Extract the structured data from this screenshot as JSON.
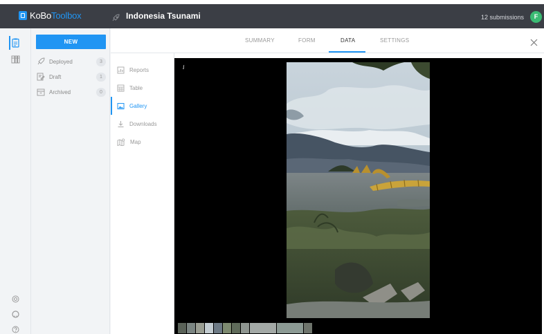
{
  "app": {
    "logo_primary": "KoBo",
    "logo_secondary": "Toolbox",
    "project_title": "Indonesia Tsunami",
    "submissions": "12 submissions",
    "avatar_initial": "F"
  },
  "sidebar": {
    "new_label": "NEW",
    "items": [
      {
        "label": "Deployed",
        "count": "3",
        "icon": "rocket-icon"
      },
      {
        "label": "Draft",
        "count": "1",
        "icon": "draft-icon"
      },
      {
        "label": "Archived",
        "count": "0",
        "icon": "archive-icon"
      }
    ]
  },
  "tabs": [
    {
      "label": "SUMMARY",
      "active": false
    },
    {
      "label": "FORM",
      "active": false
    },
    {
      "label": "DATA",
      "active": true
    },
    {
      "label": "SETTINGS",
      "active": false
    }
  ],
  "data_nav": [
    {
      "label": "Reports",
      "icon": "reports-icon",
      "active": false
    },
    {
      "label": "Table",
      "icon": "table-icon",
      "active": false
    },
    {
      "label": "Gallery",
      "icon": "gallery-icon",
      "active": true
    },
    {
      "label": "Downloads",
      "icon": "download-icon",
      "active": false
    },
    {
      "label": "Map",
      "icon": "map-icon",
      "active": false
    }
  ],
  "viewer": {
    "info_glyph": "i",
    "thumbnail_count": 12
  },
  "colors": {
    "topbar": "#3b3e45",
    "accent": "#2095f3",
    "avatar": "#3abb73"
  }
}
